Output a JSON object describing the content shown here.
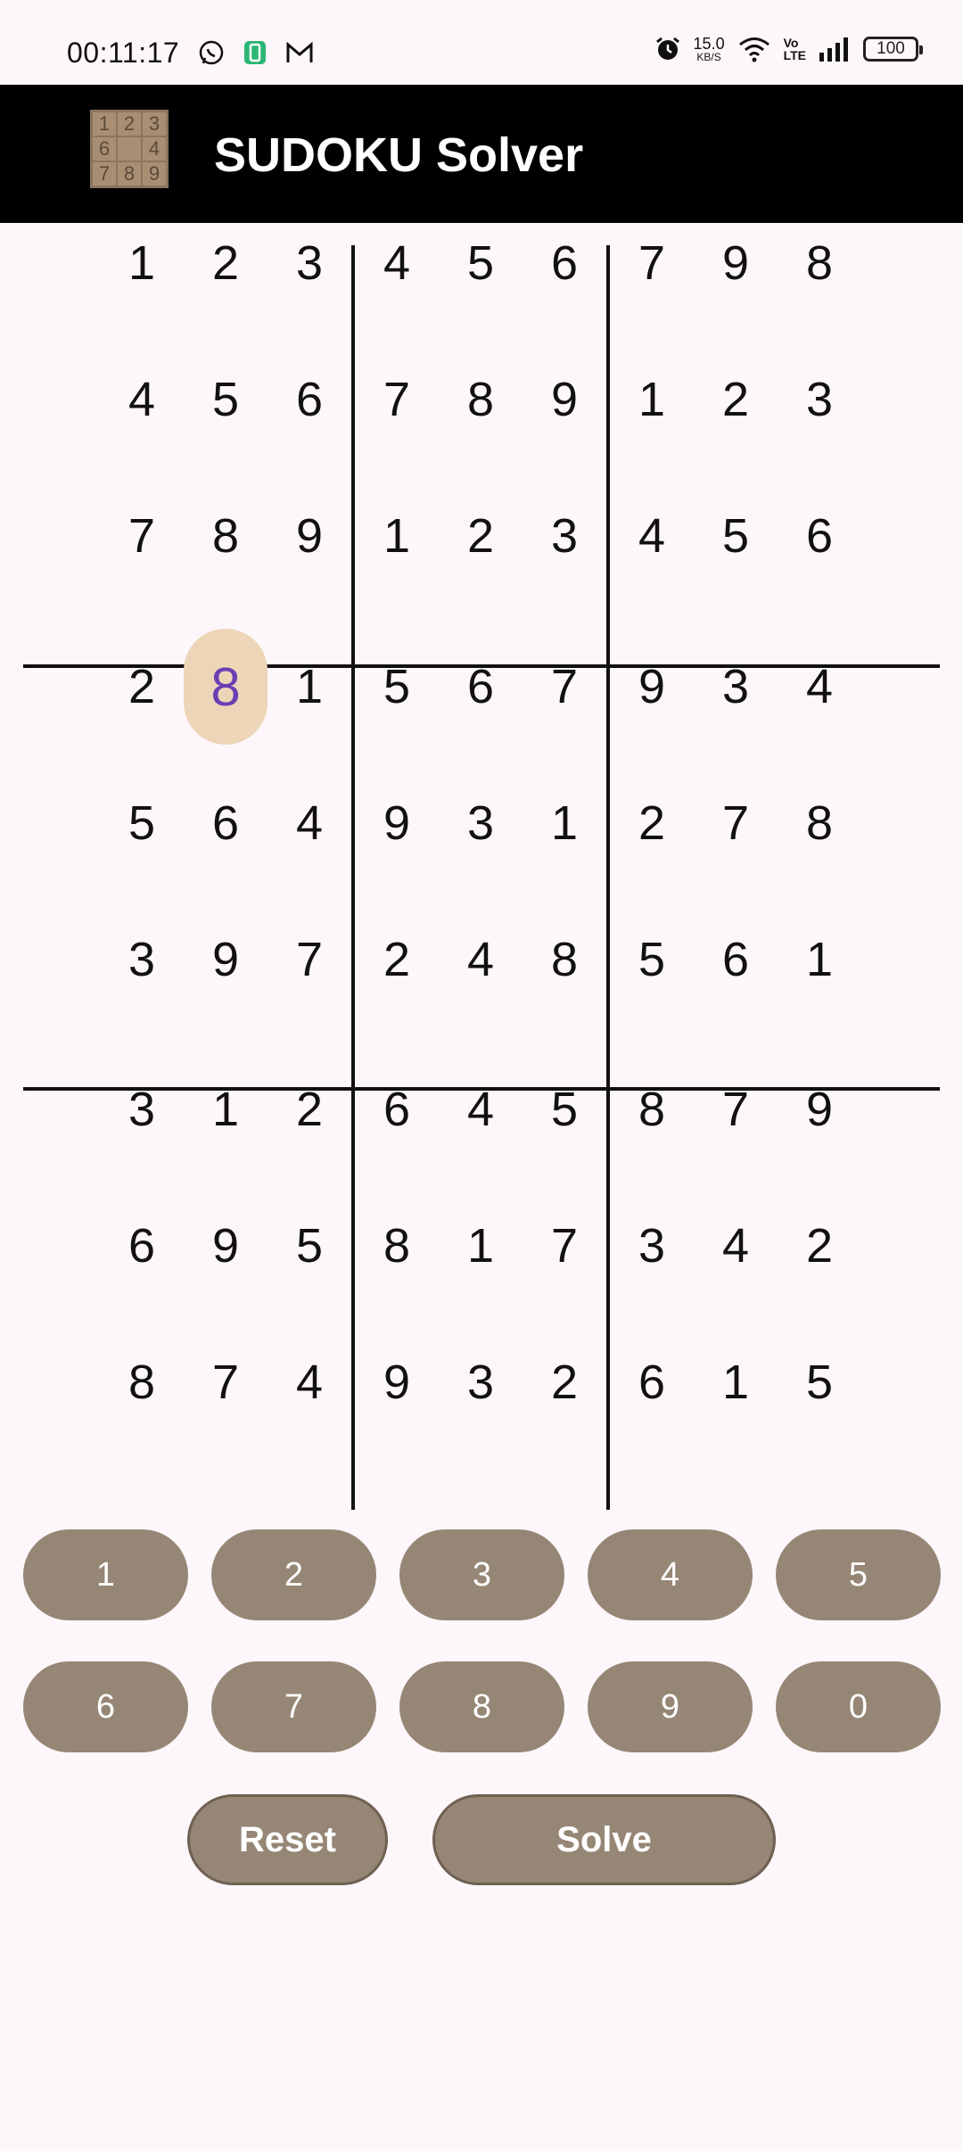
{
  "status_bar": {
    "time": "00:11:17",
    "net_speed": "15.0",
    "net_unit": "KB/S",
    "volte_top": "Vo",
    "volte_bottom": "LTE",
    "battery": "100"
  },
  "app_bar": {
    "title": "SUDOKU Solver",
    "logo_digits": [
      "1",
      "2",
      "3",
      "6",
      "",
      "4",
      "7",
      "8",
      "9"
    ]
  },
  "board": {
    "rows": [
      [
        "1",
        "2",
        "3",
        "4",
        "5",
        "6",
        "7",
        "9",
        "8"
      ],
      [
        "4",
        "5",
        "6",
        "7",
        "8",
        "9",
        "1",
        "2",
        "3"
      ],
      [
        "7",
        "8",
        "9",
        "1",
        "2",
        "3",
        "4",
        "5",
        "6"
      ],
      [
        "2",
        "8",
        "1",
        "5",
        "6",
        "7",
        "9",
        "3",
        "4"
      ],
      [
        "5",
        "6",
        "4",
        "9",
        "3",
        "1",
        "2",
        "7",
        "8"
      ],
      [
        "3",
        "9",
        "7",
        "2",
        "4",
        "8",
        "5",
        "6",
        "1"
      ],
      [
        "3",
        "1",
        "2",
        "6",
        "4",
        "5",
        "8",
        "7",
        "9"
      ],
      [
        "6",
        "9",
        "5",
        "8",
        "1",
        "7",
        "3",
        "4",
        "2"
      ],
      [
        "8",
        "7",
        "4",
        "9",
        "3",
        "2",
        "6",
        "1",
        "5"
      ]
    ],
    "selected": [
      3,
      1
    ],
    "selected_color": "#edd5b8",
    "selected_text_color": "#6a3fb3"
  },
  "keypad": {
    "keys": [
      "1",
      "2",
      "3",
      "4",
      "5",
      "6",
      "7",
      "8",
      "9",
      "0"
    ],
    "reset_label": "Reset",
    "solve_label": "Solve",
    "button_color": "#968675"
  }
}
